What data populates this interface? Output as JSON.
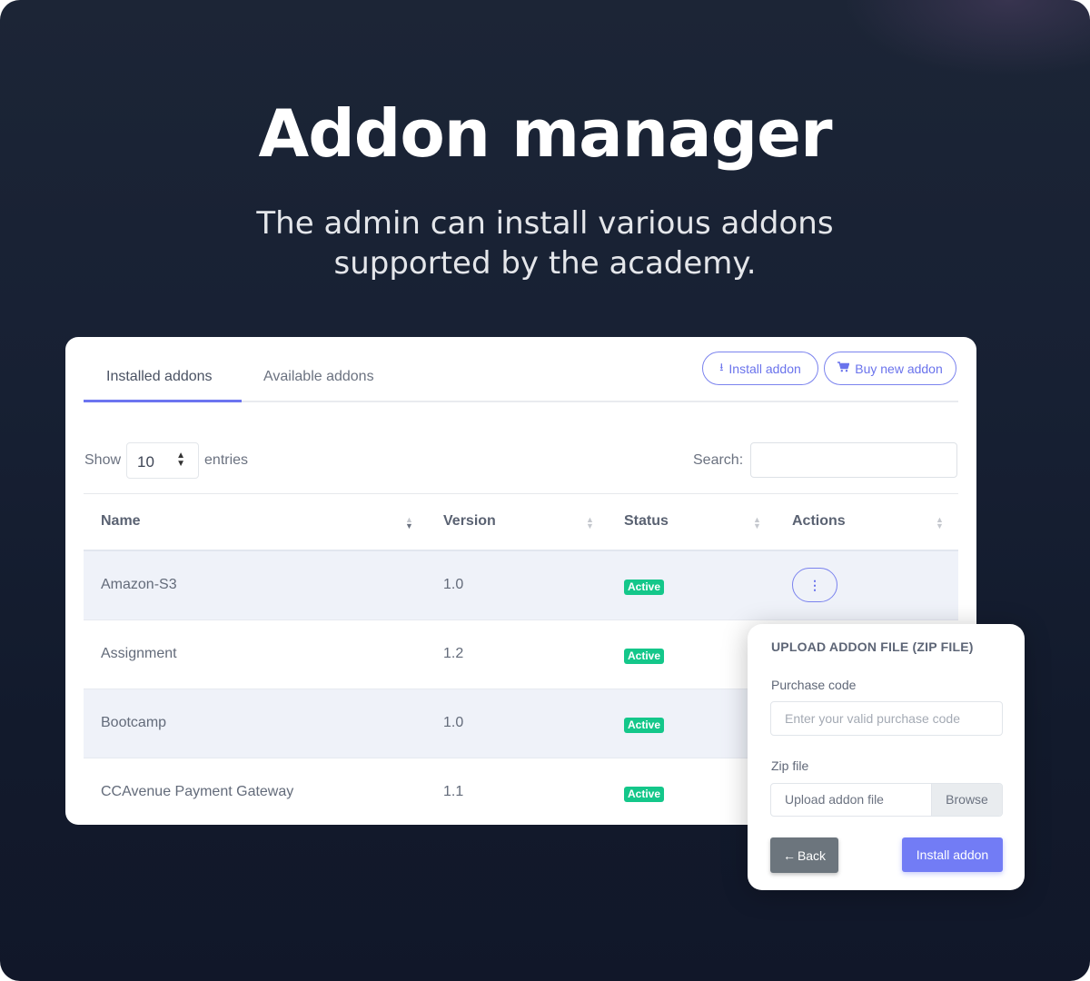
{
  "hero": {
    "title": "Addon manager",
    "subtitle_line1": "The admin can install various addons",
    "subtitle_line2": "supported by the academy."
  },
  "tabs": [
    {
      "label": "Installed addons",
      "active": true
    },
    {
      "label": "Available addons",
      "active": false
    }
  ],
  "toolbar": {
    "install_label": "Install addon",
    "install_icon": "download-icon",
    "buy_label": "Buy new addon",
    "buy_icon": "cart-icon"
  },
  "controls": {
    "show_label": "Show",
    "page_size": "10",
    "entries_label": "entries",
    "search_label": "Search:",
    "search_value": ""
  },
  "table": {
    "columns": [
      "Name",
      "Version",
      "Status",
      "Actions"
    ],
    "rows": [
      {
        "name": "Amazon-S3",
        "version": "1.0",
        "status": "Active"
      },
      {
        "name": "Assignment",
        "version": "1.2",
        "status": "Active"
      },
      {
        "name": "Bootcamp",
        "version": "1.0",
        "status": "Active"
      },
      {
        "name": "CCAvenue Payment Gateway",
        "version": "1.1",
        "status": "Active"
      }
    ],
    "actions_icon": "kebab-menu-icon"
  },
  "upload": {
    "title": "UPLOAD ADDON FILE (ZIP FILE)",
    "purchase_label": "Purchase code",
    "purchase_placeholder": "Enter your valid purchase code",
    "zip_label": "Zip file",
    "file_placeholder": "Upload addon file",
    "browse_label": "Browse",
    "back_label": "Back",
    "install_label": "Install addon"
  },
  "colors": {
    "accent": "#727cf5",
    "status_active": "#14c78a",
    "back_button": "#6c757d",
    "background": "#172033"
  }
}
